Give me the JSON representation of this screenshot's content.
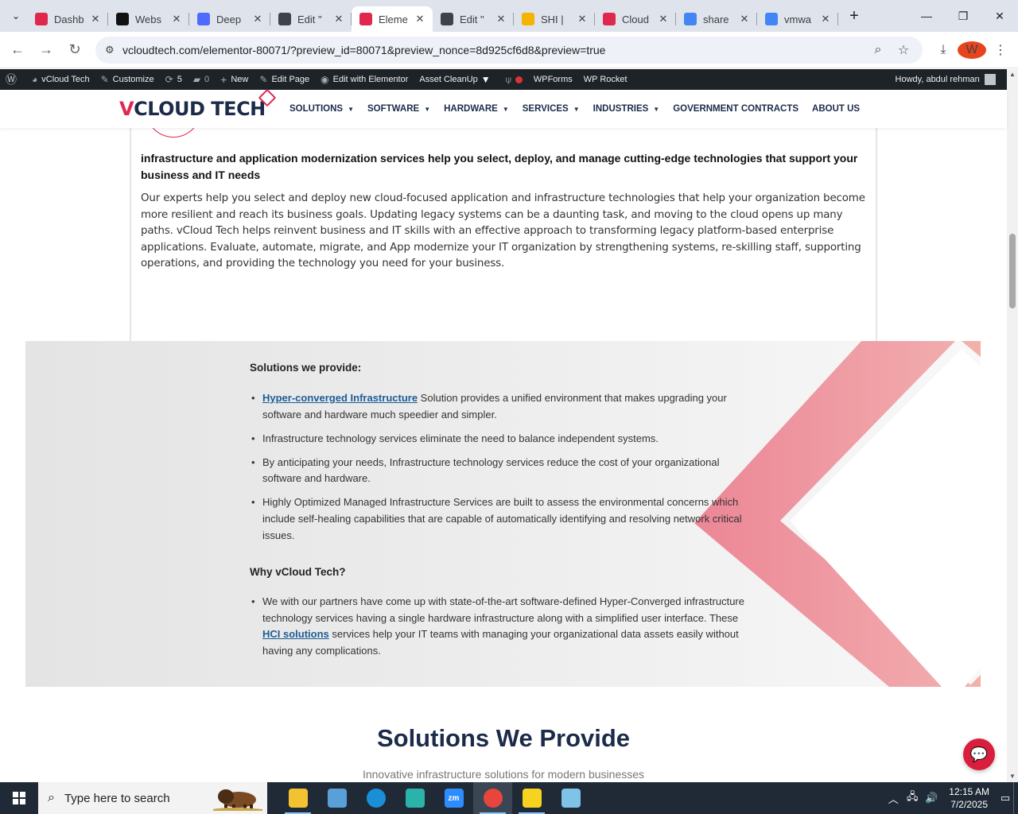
{
  "browser": {
    "tabs": [
      {
        "title": "Dashb",
        "favicon": "elementor-icon",
        "color": "#e0284f",
        "active": false
      },
      {
        "title": "Webs",
        "favicon": "openai-icon",
        "color": "#111111",
        "active": false
      },
      {
        "title": "Deep",
        "favicon": "deepseek-icon",
        "color": "#4d6bfe",
        "active": false
      },
      {
        "title": "Edit \"",
        "favicon": "wordpress-icon",
        "color": "#3c434a",
        "active": false
      },
      {
        "title": "Eleme",
        "favicon": "elementor-icon",
        "color": "#e0284f",
        "active": true
      },
      {
        "title": "Edit \"",
        "favicon": "wordpress-icon",
        "color": "#3c434a",
        "active": false
      },
      {
        "title": "SHI | ",
        "favicon": "shi-icon",
        "color": "#f4b400",
        "active": false
      },
      {
        "title": "Cloud",
        "favicon": "cloud-icon",
        "color": "#e0284f",
        "active": false
      },
      {
        "title": "share",
        "favicon": "google-icon",
        "color": "#4285f4",
        "active": false
      },
      {
        "title": "vmwa",
        "favicon": "google-icon",
        "color": "#4285f4",
        "active": false
      }
    ],
    "url": "vcloudtech.com/elementor-80071/?preview_id=80071&preview_nonce=8d925cf6d8&preview=true",
    "profile_initial": "W"
  },
  "adminbar": {
    "site": "vCloud Tech",
    "customize": "Customize",
    "updates": "5",
    "comments": "0",
    "new": "New",
    "edit_page": "Edit Page",
    "edit_elementor": "Edit with Elementor",
    "asset_cleanup": "Asset CleanUp",
    "wpforms": "WPForms",
    "wprocket": "WP Rocket",
    "howdy": "Howdy, abdul rehman"
  },
  "header": {
    "logo_v": "V",
    "logo_rest": "CLOUD TECH",
    "nav": [
      {
        "label": "SOLUTIONS",
        "dropdown": true
      },
      {
        "label": "SOFTWARE",
        "dropdown": true
      },
      {
        "label": "HARDWARE",
        "dropdown": true
      },
      {
        "label": "SERVICES",
        "dropdown": true
      },
      {
        "label": "INDUSTRIES",
        "dropdown": true
      },
      {
        "label": "GOVERNMENT CONTRACTS",
        "dropdown": false
      },
      {
        "label": "ABOUT US",
        "dropdown": false
      }
    ]
  },
  "content": {
    "lead": "infrastructure and application modernization services help you select, deploy, and manage cutting-edge technologies that support your business and IT needs",
    "body": "Our experts help you select and deploy new cloud-focused application and infrastructure technologies that help your organization become more resilient and reach its business goals. Updating legacy systems can be a daunting task, and moving to the cloud opens up many paths. vCloud Tech helps reinvent business and IT skills with an effective approach to transforming legacy platform-based enterprise applications. Evaluate, automate, migrate, and App modernize your IT organization by strengthening systems, re-skilling staff, supporting operations, and providing the technology you need for your business.",
    "solutions_heading": "Solutions we provide:",
    "item1_link": "Hyper-converged Infrastructure",
    "item1_rest": " Solution provides a unified environment that makes upgrading your software and hardware much speedier and simpler.",
    "item2": "Infrastructure technology services eliminate the need to balance independent systems.",
    "item3": "By anticipating your needs, Infrastructure technology services reduce the cost of your organizational software and hardware.",
    "item4": "Highly Optimized Managed Infrastructure Services are built to assess the environmental concerns which include self-healing capabilities that are capable of automatically identifying and resolving network critical issues.",
    "why_heading": "Why vCloud Tech?",
    "why_pre": "We with our partners have come up with state-of-the-art software-defined Hyper-Converged infrastructure technology services having a single hardware infrastructure along with a simplified user interface. These ",
    "why_link": "HCI solutions",
    "why_post": " services help your IT teams with managing your organizational data assets easily without having any complications.",
    "section_title": "Solutions We Provide",
    "section_sub": "Innovative infrastructure solutions for modern businesses"
  },
  "taskbar": {
    "search_placeholder": "Type here to search",
    "time": "12:15 AM",
    "date": "7/2/2025",
    "apps": [
      {
        "name": "file-explorer-icon",
        "color": "#f2c230",
        "label": ""
      },
      {
        "name": "paint-icon",
        "color": "#5aa0d8",
        "label": ""
      },
      {
        "name": "edge-icon",
        "color": "#1a8fd6",
        "label": ""
      },
      {
        "name": "app-icon",
        "color": "#2bb3a9",
        "label": ""
      },
      {
        "name": "zoom-icon",
        "color": "#2d8cff",
        "label": "zm"
      },
      {
        "name": "chrome-icon",
        "color": "#e8453c",
        "label": ""
      },
      {
        "name": "sticky-notes-icon",
        "color": "#f7d21f",
        "label": ""
      },
      {
        "name": "app2-icon",
        "color": "#7fc3e8",
        "label": ""
      }
    ]
  }
}
